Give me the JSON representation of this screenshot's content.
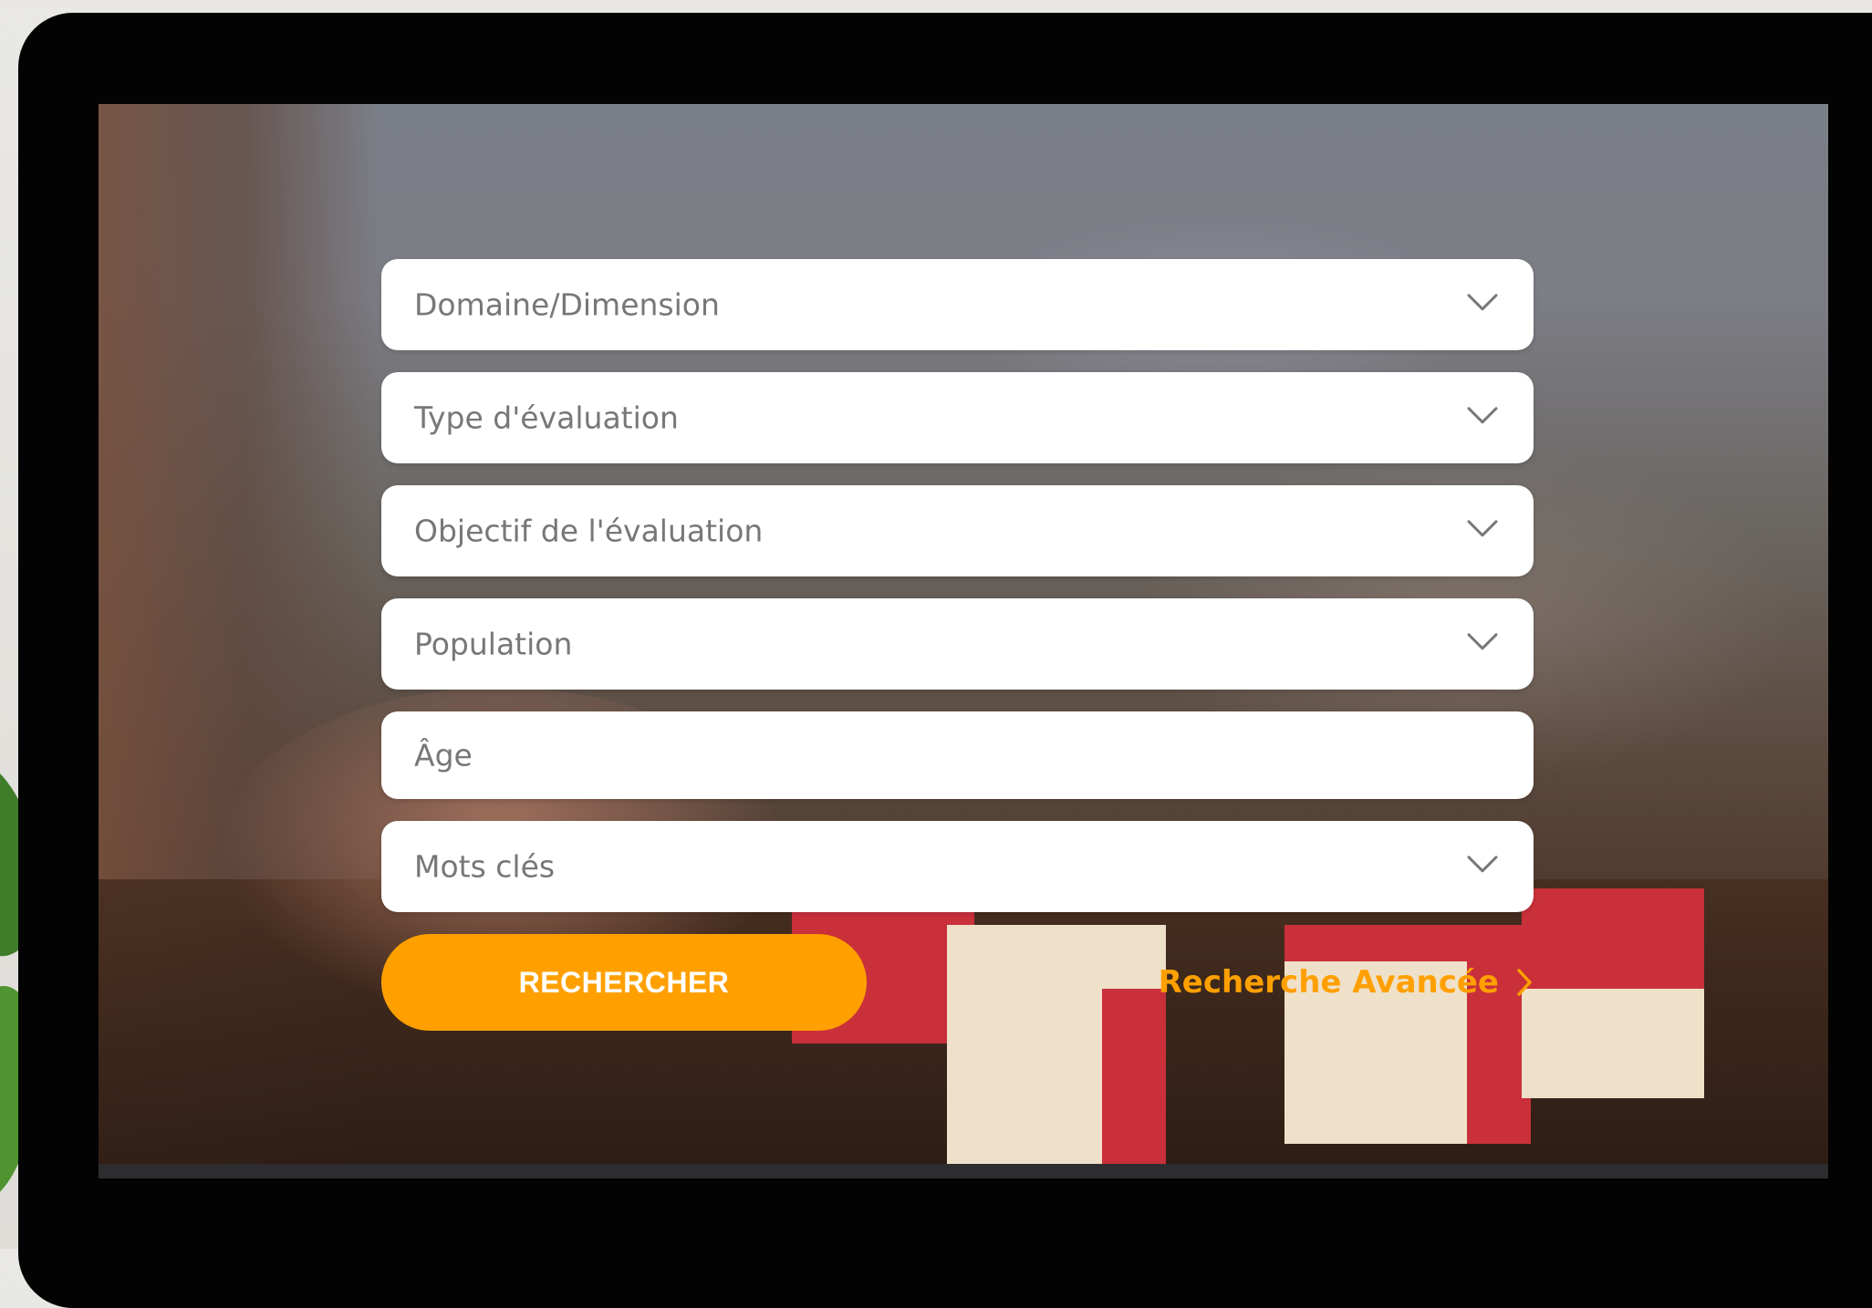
{
  "form": {
    "fields": [
      {
        "label": "Domaine/Dimension",
        "type": "select"
      },
      {
        "label": "Type d'évaluation",
        "type": "select"
      },
      {
        "label": "Objectif de l'évaluation",
        "type": "select"
      },
      {
        "label": "Population",
        "type": "select"
      },
      {
        "label": "Âge",
        "type": "input"
      },
      {
        "label": "Mots clés",
        "type": "select"
      }
    ],
    "search_button": "RECHERCHER",
    "advanced_link": "Recherche Avancée"
  },
  "colors": {
    "accent": "#ffa000",
    "field_bg": "#ffffff",
    "placeholder": "#777777",
    "device_frame": "#030303"
  },
  "icons": {
    "dropdown": "chevron-down-icon",
    "advanced": "chevron-right-icon"
  }
}
